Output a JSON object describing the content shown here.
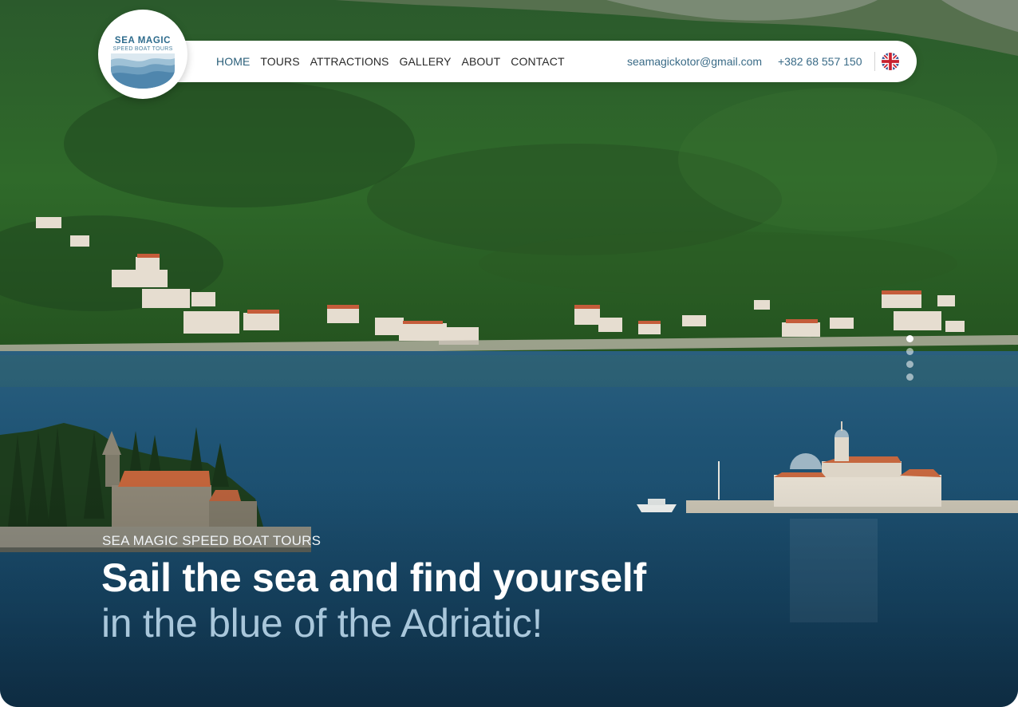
{
  "brand": {
    "name": "SEA MAGIC",
    "tagline": "SPEED BOAT TOURS"
  },
  "nav": {
    "items": [
      {
        "label": "HOME",
        "active": true
      },
      {
        "label": "TOURS",
        "active": false
      },
      {
        "label": "ATTRACTIONS",
        "active": false
      },
      {
        "label": "GALLERY",
        "active": false
      },
      {
        "label": "ABOUT",
        "active": false
      },
      {
        "label": "CONTACT",
        "active": false
      }
    ],
    "email": "seamagickotor@gmail.com",
    "phone": "+382 68 557 150",
    "language_icon": "uk-flag-icon"
  },
  "hero": {
    "kicker": "SEA MAGIC SPEED BOAT TOURS",
    "headline": "Sail the sea and find yourself",
    "subline": "in the blue of the Adriatic!",
    "slides_total": 4,
    "slide_active": 1
  },
  "colors": {
    "accent": "#2b5f7a",
    "subline": "#a9c7db",
    "sea": "#1c4d6e",
    "forest": "#2d5e28"
  }
}
